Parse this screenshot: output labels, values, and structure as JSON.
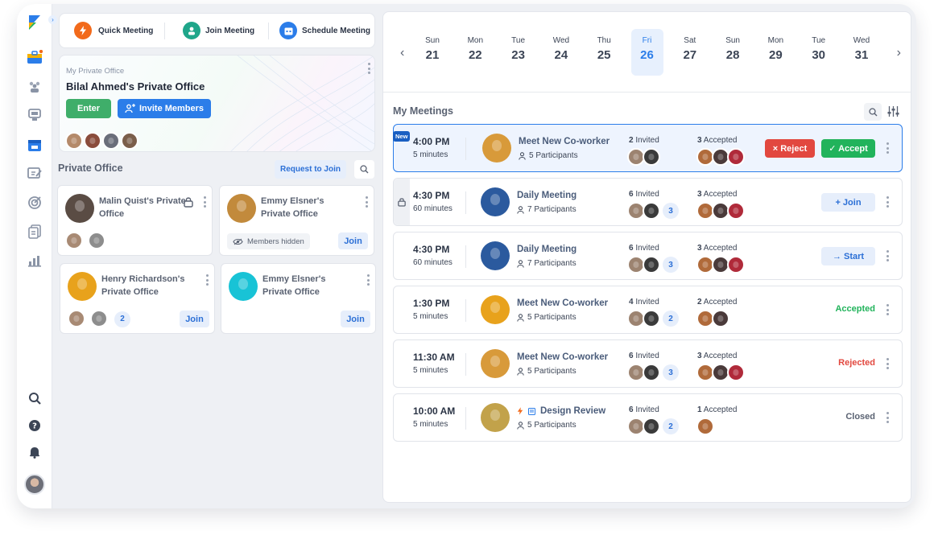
{
  "top_actions": {
    "quick_meeting": "Quick Meeting",
    "join_meeting": "Join Meeting",
    "schedule_meeting": "Schedule Meeting"
  },
  "office": {
    "subtitle": "My Private Office",
    "title": "Bilal Ahmed's Private Office",
    "enter_label": "Enter",
    "invite_label": "Invite Members"
  },
  "private_office": {
    "heading": "Private Office",
    "request_label": "Request to Join",
    "cards": [
      {
        "name": "Malin Quist's Private Office"
      },
      {
        "name": "Emmy Elsner's Private Office",
        "members_hidden": "Members hidden",
        "join": "Join"
      },
      {
        "name": "Henry Richardson's Private Office",
        "count": "2",
        "join": "Join"
      },
      {
        "name": "Emmy Elsner's Private Office",
        "join": "Join"
      }
    ]
  },
  "calendar": {
    "days": [
      {
        "d": "Sun",
        "n": "21"
      },
      {
        "d": "Mon",
        "n": "22"
      },
      {
        "d": "Tue",
        "n": "23"
      },
      {
        "d": "Wed",
        "n": "24"
      },
      {
        "d": "Thu",
        "n": "25"
      },
      {
        "d": "Fri",
        "n": "26"
      },
      {
        "d": "Sat",
        "n": "27"
      },
      {
        "d": "Sun",
        "n": "28"
      },
      {
        "d": "Mon",
        "n": "29"
      },
      {
        "d": "Tue",
        "n": "30"
      },
      {
        "d": "Wed",
        "n": "31"
      }
    ],
    "selected": "26"
  },
  "meetings_heading": "My Meetings",
  "meetings": [
    {
      "badge": "New",
      "time": "4:00 PM",
      "duration": "5 minutes",
      "title": "Meet New Co-worker",
      "participants": "5 Participants",
      "invited_num": "2",
      "invited_label": " Invited",
      "accepted_num": "3",
      "accepted_label": " Accepted",
      "reject": "× Reject",
      "accept": "✓ Accept"
    },
    {
      "time": "4:30 PM",
      "duration": "60 minutes",
      "title": "Daily Meeting",
      "participants": "7 Participants",
      "invited_num": "6",
      "invited_label": " Invited",
      "invited_more": "3",
      "accepted_num": "3",
      "accepted_label": " Accepted",
      "action": "+ Join"
    },
    {
      "time": "4:30 PM",
      "duration": "60 minutes",
      "title": "Daily Meeting",
      "participants": "7 Participants",
      "invited_num": "6",
      "invited_label": " Invited",
      "invited_more": "3",
      "accepted_num": "3",
      "accepted_label": " Accepted",
      "action": "→ Start"
    },
    {
      "time": "1:30 PM",
      "duration": "5 minutes",
      "title": "Meet New Co-worker",
      "participants": "5 Participants",
      "invited_num": "4",
      "invited_label": " Invited",
      "invited_more": "2",
      "accepted_num": "2",
      "accepted_label": " Accepted",
      "status": "Accepted"
    },
    {
      "time": "11:30 AM",
      "duration": "5 minutes",
      "title": "Meet New Co-worker",
      "participants": "5 Participants",
      "invited_num": "6",
      "invited_label": " Invited",
      "invited_more": "3",
      "accepted_num": "3",
      "accepted_label": " Accepted",
      "status": "Rejected"
    },
    {
      "time": "10:00 AM",
      "duration": "5 minutes",
      "title": "Design Review",
      "participants": "5 Participants",
      "invited_num": "6",
      "invited_label": " Invited",
      "invited_more": "2",
      "accepted_num": "1",
      "accepted_label": " Accepted",
      "status": "Closed"
    }
  ],
  "colors": {
    "primary": "#2b7de9",
    "green": "#21b35b",
    "red": "#e2483f",
    "orange": "#f26a1b",
    "teal": "#1fa68a",
    "selected_day_bg": "#e7f0fd",
    "new_row_bg": "#eef4fe"
  },
  "icons": [
    "logo-icon",
    "office-icon",
    "team-icon",
    "whiteboard-icon",
    "calendar-icon",
    "notes-icon",
    "target-icon",
    "files-icon",
    "chart-icon",
    "search-icon",
    "help-icon",
    "bell-icon",
    "lock-icon",
    "kebab-icon",
    "filter-icon",
    "eye-icon",
    "bolt-icon",
    "person-icon"
  ]
}
